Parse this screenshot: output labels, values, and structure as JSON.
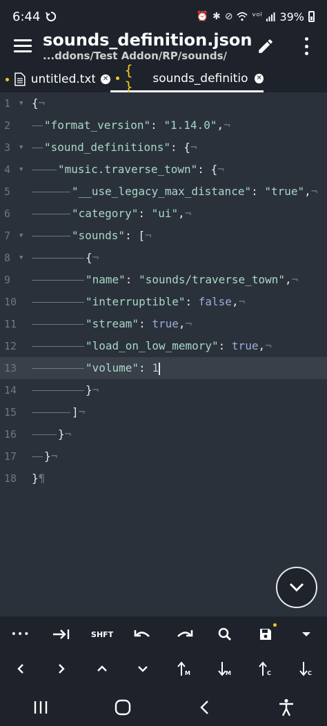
{
  "status": {
    "time": "6:44",
    "battery": "39%"
  },
  "app_bar": {
    "title": "sounds_definition.json",
    "path": "...ddons/Test Addon/RP/sounds/"
  },
  "tabs": [
    {
      "label": "untitled.txt"
    },
    {
      "label": "sounds_definitio..."
    }
  ],
  "editor": {
    "line_numbers": [
      "1",
      "2",
      "3",
      "4",
      "5",
      "6",
      "7",
      "8",
      "9",
      "10",
      "11",
      "12",
      "13",
      "14",
      "15",
      "16",
      "17",
      "18"
    ],
    "lines": {
      "l1": "{",
      "l2_key": "\"format_version\"",
      "l2_val": "\"1.14.0\"",
      "l3_key": "\"sound_definitions\"",
      "l4_key": "\"music.traverse_town\"",
      "l5_key": "\"__use_legacy_max_distance\"",
      "l5_val": "\"true\"",
      "l6_key": "\"category\"",
      "l6_val": "\"ui\"",
      "l7_key": "\"sounds\"",
      "l9_key": "\"name\"",
      "l9_val": "\"sounds/traverse_town\"",
      "l10_key": "\"interruptible\"",
      "l10_val": "false",
      "l11_key": "\"stream\"",
      "l11_val": "true",
      "l12_key": "\"load_on_low_memory\"",
      "l12_val": "true",
      "l13_key": "\"volume\"",
      "l13_val": "1"
    }
  },
  "toolbar": {
    "dots": "•••",
    "shift": "SHFT"
  },
  "colors": {
    "accent": "#f3c623",
    "background": "#2b313b",
    "bar": "#1e232b"
  }
}
